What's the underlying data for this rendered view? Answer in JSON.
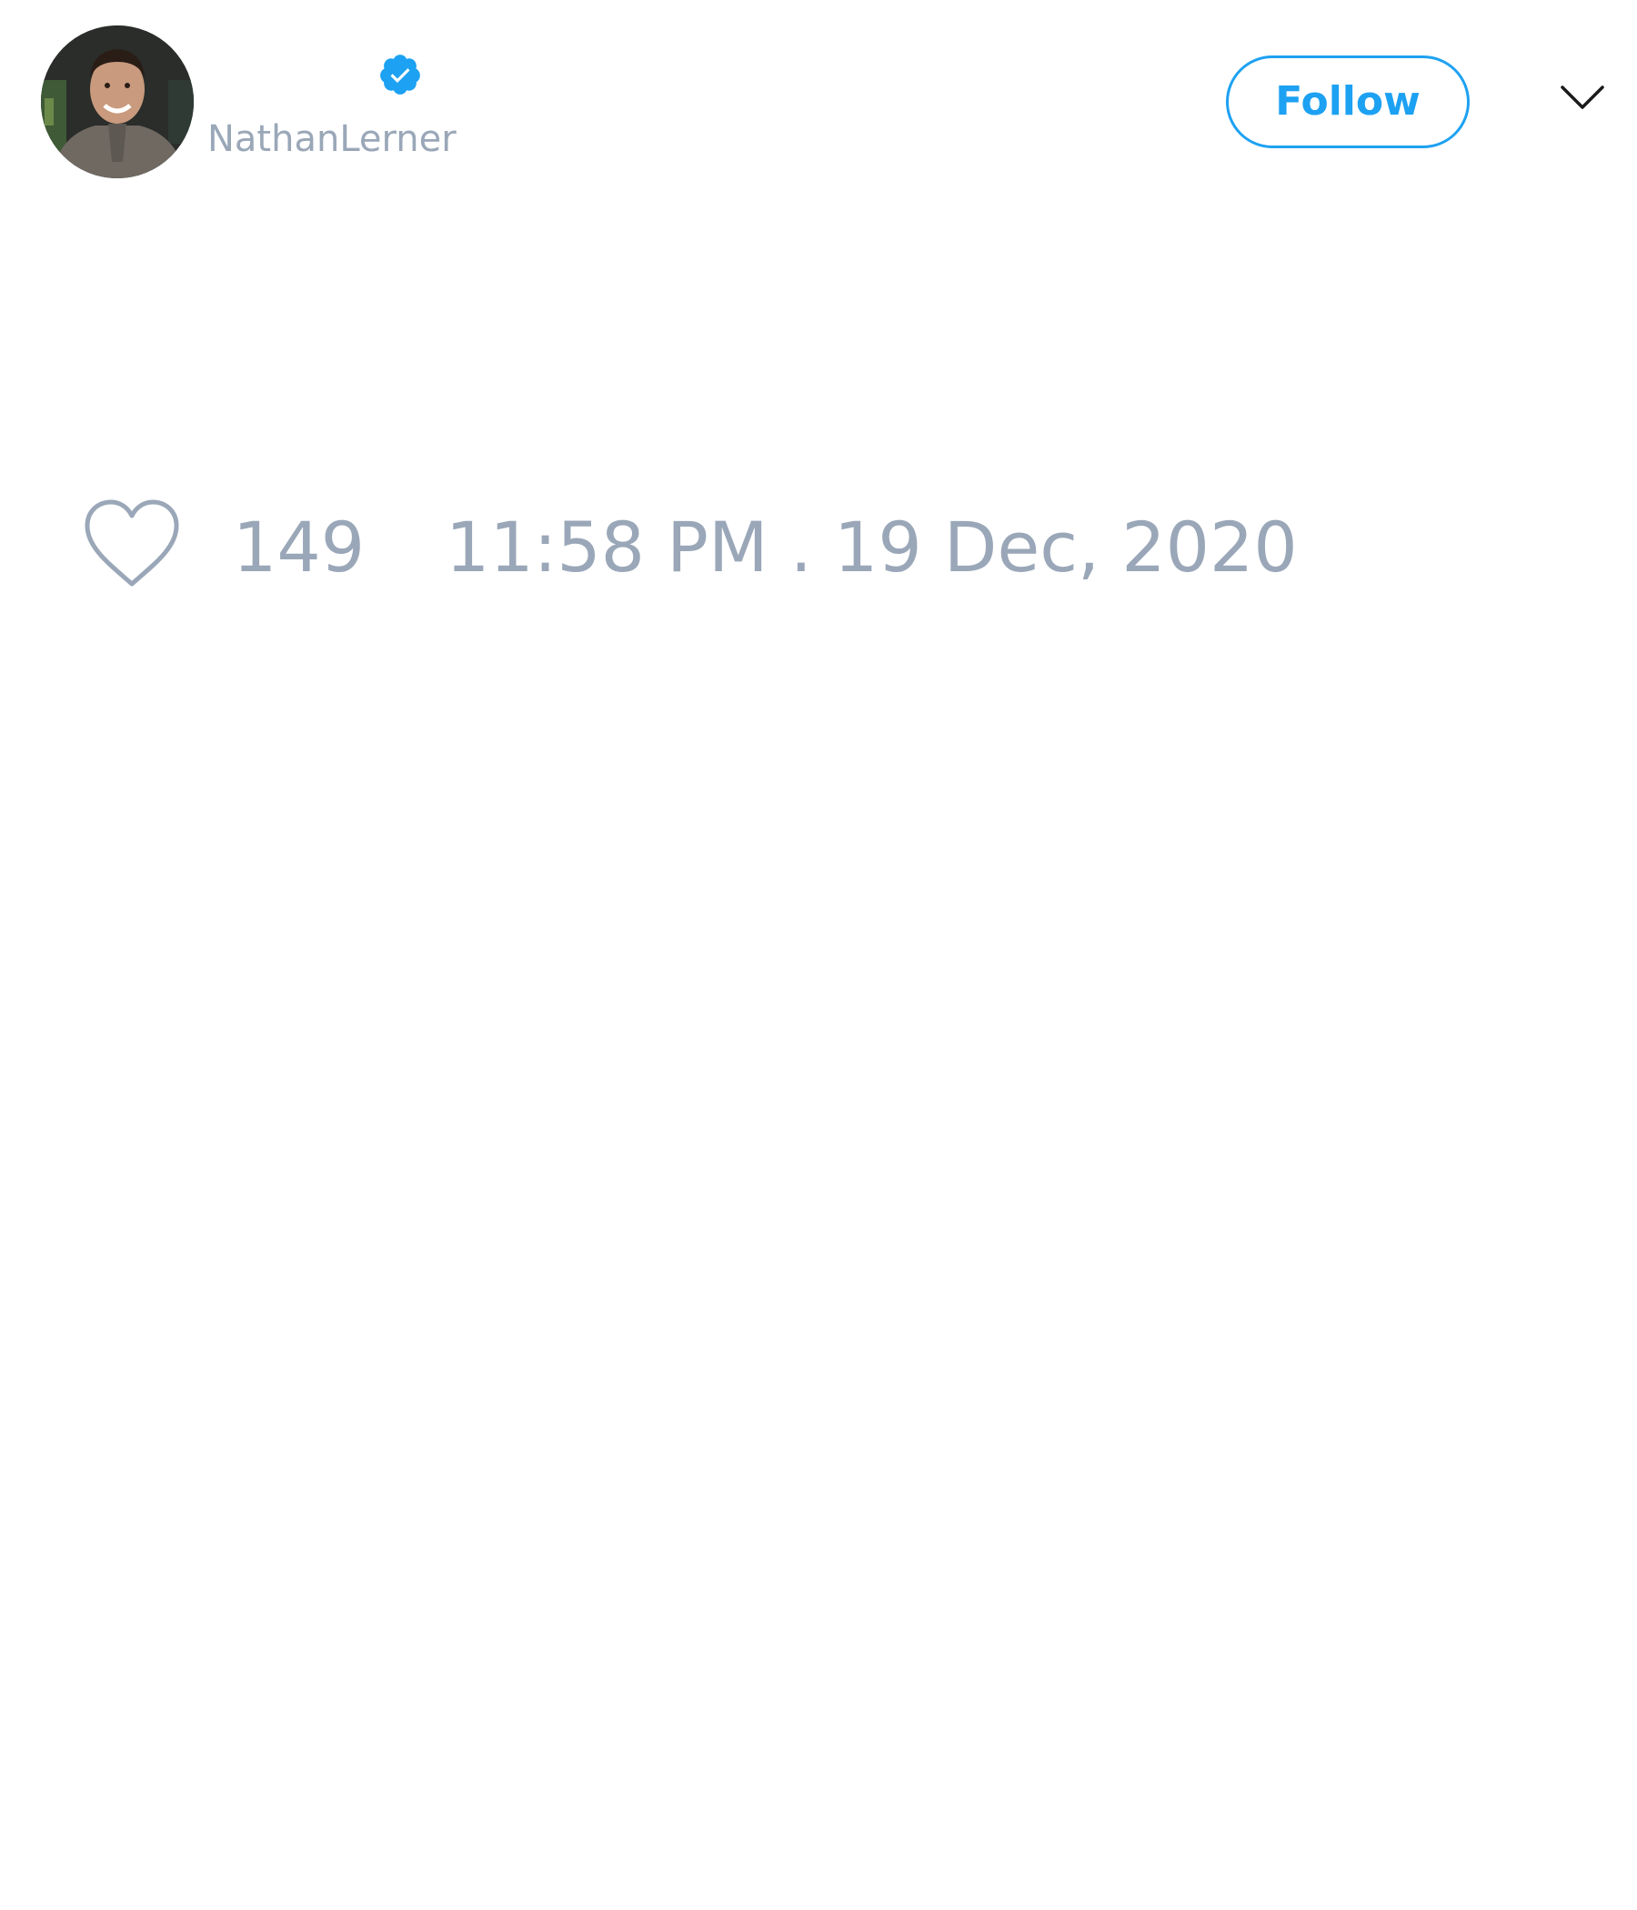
{
  "tweet": {
    "author": {
      "handle": "NathanLerner",
      "avatar_icon": "user-avatar",
      "verified": true,
      "verified_icon": "verified-badge-icon"
    },
    "follow_button_label": "Follow",
    "menu_icon": "chevron-down-icon",
    "like_icon": "heart-outline-icon",
    "like_count": "149",
    "timestamp": "11:58 PM . 19 Dec, 2020"
  },
  "colors": {
    "accent": "#1da1f2",
    "muted_text": "#9aa7b8",
    "background": "#ffffff",
    "icon_dark": "#1a1a1a"
  }
}
